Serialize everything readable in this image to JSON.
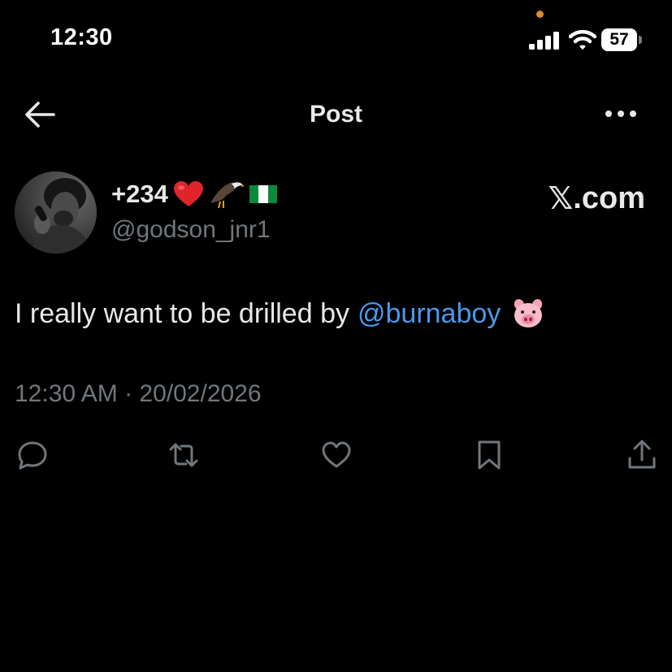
{
  "status_bar": {
    "time": "12:30",
    "battery": "57"
  },
  "header": {
    "title": "Post"
  },
  "author": {
    "display_name": "+234",
    "name_emojis": [
      "red-heart",
      "eagle",
      "nigeria-flag"
    ],
    "handle": "@godson_jnr1"
  },
  "watermark": {
    "logo_text": "𝕏",
    "suffix": ".com"
  },
  "tweet": {
    "text": "I really want to be drilled by",
    "mention": "@burnaboy",
    "emoji": "pig-face",
    "timestamp": "12:30 AM · 20/02/2026"
  },
  "actions": [
    "reply-icon",
    "repost-icon",
    "like-icon",
    "bookmark-icon",
    "share-icon"
  ],
  "colors": {
    "background": "#000000",
    "text_primary": "#e7e9ea",
    "text_secondary": "#71767b",
    "link": "#4a99e9"
  }
}
